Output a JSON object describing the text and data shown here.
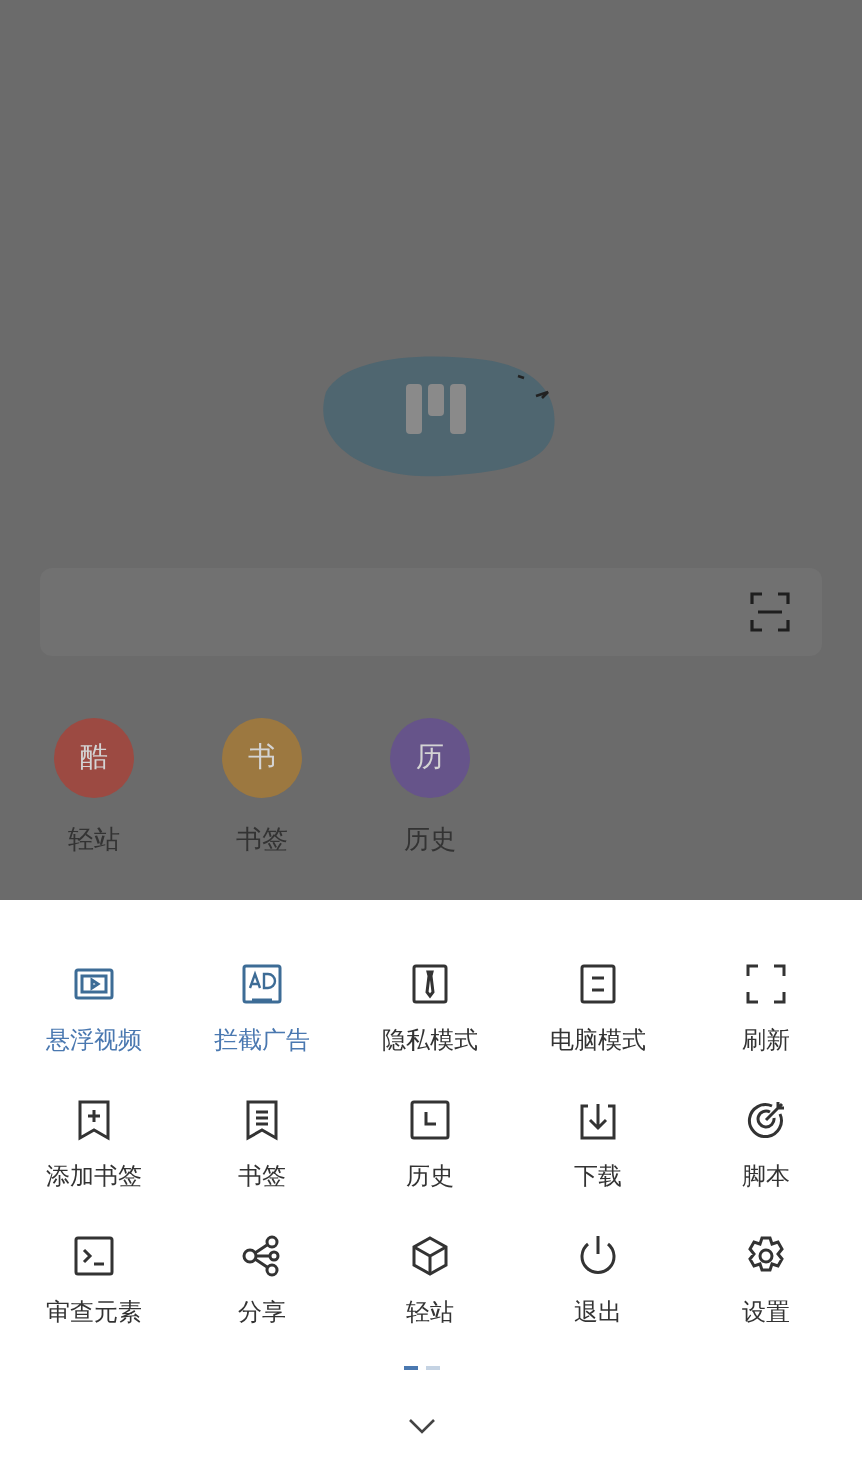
{
  "home": {
    "shortcuts": [
      {
        "glyph": "酷",
        "label": "轻站",
        "color": "#9c4a42"
      },
      {
        "glyph": "书",
        "label": "书签",
        "color": "#9c7840"
      },
      {
        "glyph": "历",
        "label": "历史",
        "color": "#66548a"
      }
    ]
  },
  "menu": {
    "items": [
      {
        "label": "悬浮视频",
        "on": true
      },
      {
        "label": "拦截广告",
        "on": true
      },
      {
        "label": "隐私模式",
        "on": false
      },
      {
        "label": "电脑模式",
        "on": false
      },
      {
        "label": "刷新",
        "on": false
      },
      {
        "label": "添加书签",
        "on": false
      },
      {
        "label": "书签",
        "on": false
      },
      {
        "label": "历史",
        "on": false
      },
      {
        "label": "下载",
        "on": false
      },
      {
        "label": "脚本",
        "on": false
      },
      {
        "label": "审查元素",
        "on": false
      },
      {
        "label": "分享",
        "on": false
      },
      {
        "label": "轻站",
        "on": false
      },
      {
        "label": "退出",
        "on": false
      },
      {
        "label": "设置",
        "on": false
      }
    ],
    "pages": [
      {
        "selected": true
      },
      {
        "selected": false
      }
    ]
  }
}
